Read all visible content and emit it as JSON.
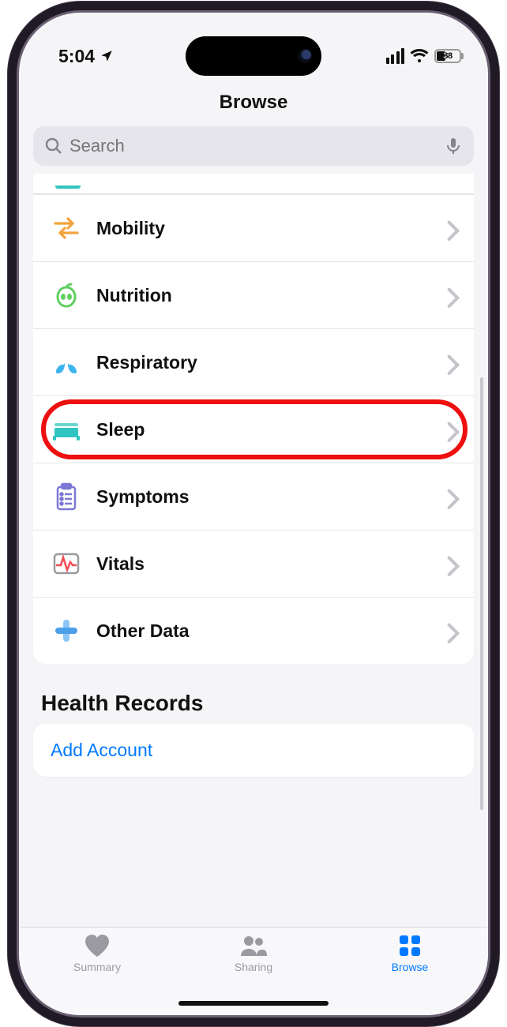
{
  "status": {
    "time": "5:04",
    "battery_pct": "38"
  },
  "nav": {
    "title": "Browse"
  },
  "search": {
    "placeholder": "Search"
  },
  "categories": [
    {
      "label": "Mobility",
      "icon": "mobility-icon"
    },
    {
      "label": "Nutrition",
      "icon": "nutrition-icon"
    },
    {
      "label": "Respiratory",
      "icon": "respiratory-icon"
    },
    {
      "label": "Sleep",
      "icon": "sleep-icon",
      "highlighted": true
    },
    {
      "label": "Symptoms",
      "icon": "symptoms-icon"
    },
    {
      "label": "Vitals",
      "icon": "vitals-icon"
    },
    {
      "label": "Other Data",
      "icon": "other-data-icon"
    }
  ],
  "health_records": {
    "header": "Health Records",
    "add_account_label": "Add Account"
  },
  "tabs": {
    "summary": "Summary",
    "sharing": "Sharing",
    "browse": "Browse"
  },
  "colors": {
    "highlight": "#ee1010",
    "link": "#0079ff",
    "orange": "#f2a33c",
    "green": "#60cf60",
    "blue": "#3eb4ef",
    "teal": "#30c5c0",
    "purple": "#7a78d4",
    "red": "#ef4d55",
    "lightblue": "#8cc5f5"
  }
}
